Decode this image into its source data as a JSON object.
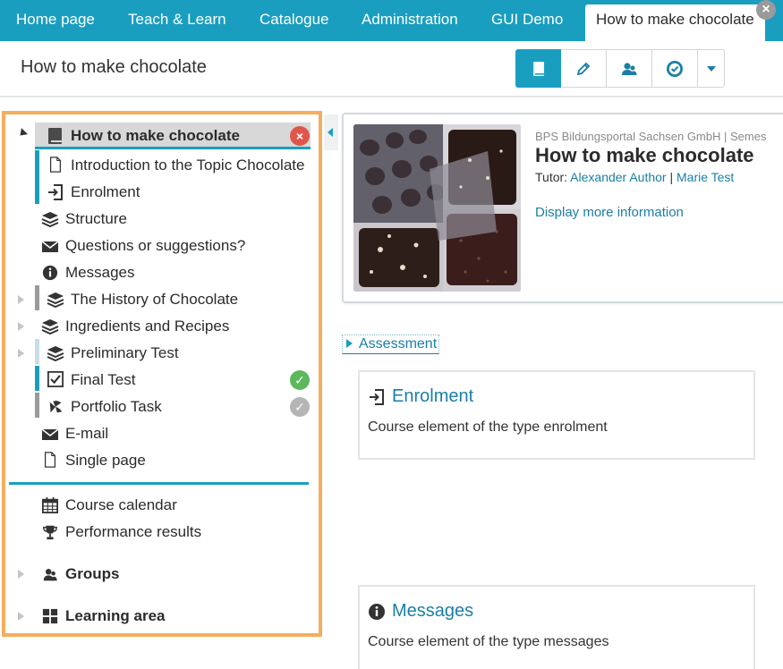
{
  "nav": {
    "tabs": [
      {
        "label": "Home page"
      },
      {
        "label": "Teach & Learn"
      },
      {
        "label": "Catalogue"
      },
      {
        "label": "Administration"
      },
      {
        "label": "GUI Demo"
      }
    ],
    "active_tab": "How to make chocolate"
  },
  "header": {
    "title": "How to make chocolate",
    "toolbar": [
      "book-icon",
      "pencil-icon",
      "members-icon",
      "badge-icon",
      "chevron-down-icon"
    ]
  },
  "sidebar": {
    "items": [
      {
        "label": "How to make chocolate",
        "icon": "book-icon",
        "expanded": true,
        "selected": true,
        "status": "error"
      },
      {
        "label": "Introduction to the Topic Chocolate",
        "icon": "page-icon"
      },
      {
        "label": "Enrolment",
        "icon": "enrolment-icon"
      },
      {
        "label": "Structure",
        "icon": "layers-icon"
      },
      {
        "label": "Questions or suggestions?",
        "icon": "mail-icon"
      },
      {
        "label": "Messages",
        "icon": "info-icon"
      },
      {
        "label": "The History of Chocolate",
        "icon": "layers-icon",
        "expandable": true
      },
      {
        "label": "Ingredients and Recipes",
        "icon": "layers-icon",
        "expandable": true
      },
      {
        "label": "Preliminary Test",
        "icon": "layers-icon",
        "expandable": true
      },
      {
        "label": "Final Test",
        "icon": "checkbox-icon",
        "status": "passed"
      },
      {
        "label": "Portfolio Task",
        "icon": "portfolio-icon",
        "status": "done"
      },
      {
        "label": "E-mail",
        "icon": "mail-icon"
      },
      {
        "label": "Single page",
        "icon": "page-icon"
      }
    ],
    "tools": [
      {
        "label": "Course calendar",
        "icon": "calendar-icon"
      },
      {
        "label": "Performance results",
        "icon": "trophy-icon"
      }
    ],
    "sections": [
      {
        "label": "Groups",
        "icon": "groups-icon"
      },
      {
        "label": "Learning area",
        "icon": "grid-icon"
      }
    ]
  },
  "course": {
    "provider": "BPS Bildungsportal Sachsen GmbH | Semes",
    "title": "How to make chocolate",
    "tutor_label": "Tutor:",
    "tutors": [
      "Alexander Author",
      "Marie Test"
    ],
    "tutor_sep": "|",
    "more_info": "Display more information"
  },
  "assessment": {
    "label": "Assessment"
  },
  "elements": [
    {
      "title": "Enrolment",
      "description": "Course element of the type enrolment",
      "icon": "enrolment-icon"
    },
    {
      "title": "Messages",
      "description": "Course element of the type messages",
      "icon": "info-icon"
    }
  ],
  "colors": {
    "accent": "#1a9ec0",
    "highlight": "#f5ad5d",
    "error": "#e0564b",
    "success": "#5cb85c",
    "done": "#b5b5b5"
  }
}
